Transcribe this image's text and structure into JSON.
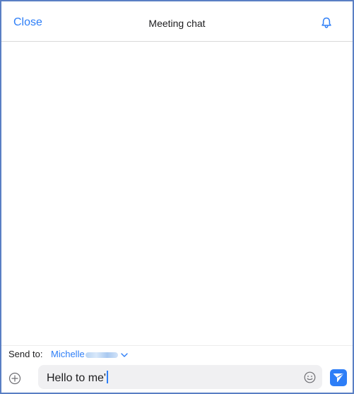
{
  "header": {
    "close_label": "Close",
    "title": "Meeting chat",
    "bell_icon": "bell-icon"
  },
  "send_to": {
    "label": "Send to:",
    "recipient": "Michelle",
    "dropdown_icon": "chevron-down-icon"
  },
  "composer": {
    "add_icon": "plus-circle-icon",
    "input_value": "Hello to me'",
    "emoji_icon": "emoji-icon",
    "send_icon": "send-icon"
  },
  "colors": {
    "accent": "#2d7ef7",
    "frame_border": "#5a7fc4",
    "input_background": "#f0f0f2"
  }
}
